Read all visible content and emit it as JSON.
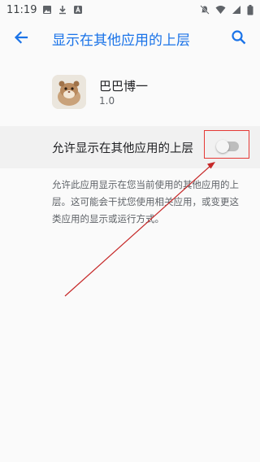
{
  "status_bar": {
    "time": "11:19",
    "left_icons": [
      "image-icon",
      "download-icon",
      "notification-a-icon"
    ],
    "right_icons": [
      "mute-icon",
      "wifi-icon",
      "signal-icon",
      "battery-icon"
    ]
  },
  "app_bar": {
    "title": "显示在其他应用的上层",
    "back_icon": "arrow-back-icon",
    "search_icon": "search-icon"
  },
  "app_info": {
    "name": "巴巴博一",
    "version": "1.0"
  },
  "setting": {
    "label": "允许显示在其他应用的上层",
    "enabled": false
  },
  "description": "允许此应用显示在您当前使用的其他应用的上层。这可能会干扰您使用相关应用，或变更这类应用的显示或运行方式。",
  "colors": {
    "accent": "#1a73e8",
    "highlight": "#e53935",
    "annotation": "#c62828"
  }
}
